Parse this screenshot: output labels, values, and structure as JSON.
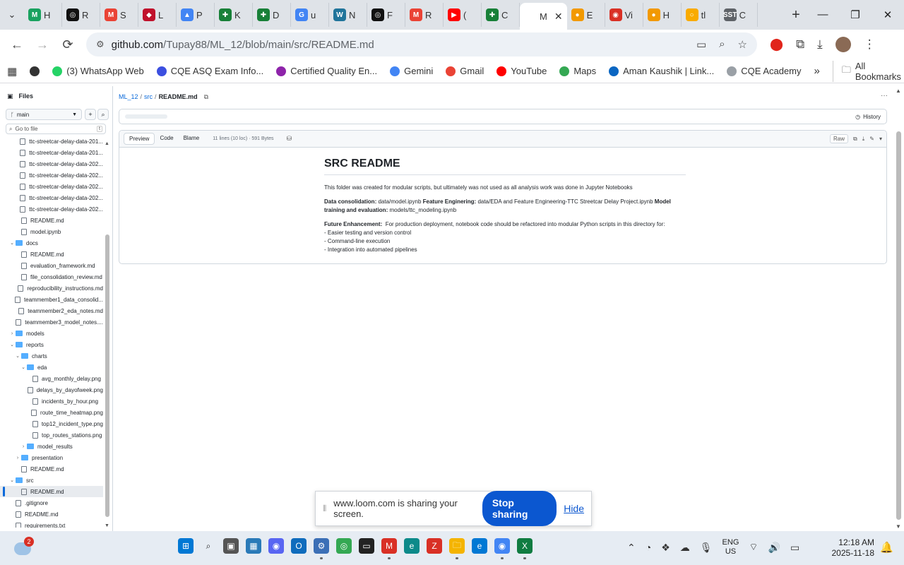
{
  "browser": {
    "tabs": [
      {
        "label": "H",
        "color": "#1aa260",
        "glyph": "M"
      },
      {
        "label": "R",
        "color": "#111111",
        "glyph": "◎"
      },
      {
        "label": "S",
        "color": "#ea4335",
        "glyph": "M"
      },
      {
        "label": "L",
        "color": "#c0122c",
        "glyph": "◆"
      },
      {
        "label": "P",
        "color": "#4285f4",
        "glyph": "▲"
      },
      {
        "label": "K",
        "color": "#188038",
        "glyph": "✚"
      },
      {
        "label": "D",
        "color": "#188038",
        "glyph": "✚"
      },
      {
        "label": "u",
        "color": "#4285f4",
        "glyph": "G"
      },
      {
        "label": "N",
        "color": "#21759b",
        "glyph": "W"
      },
      {
        "label": "F",
        "color": "#111111",
        "glyph": "◎"
      },
      {
        "label": "R",
        "color": "#ea4335",
        "glyph": "M"
      },
      {
        "label": "(",
        "color": "#ff0000",
        "glyph": "▶"
      },
      {
        "label": "C",
        "color": "#188038",
        "glyph": "✚"
      },
      {
        "label": "M",
        "color": "#ffffff",
        "glyph": "",
        "active": true
      },
      {
        "label": "E",
        "color": "#f29900",
        "glyph": "●"
      },
      {
        "label": "Vi",
        "color": "#d93025",
        "glyph": "◉"
      },
      {
        "label": "H",
        "color": "#f29900",
        "glyph": "●"
      },
      {
        "label": "tl",
        "color": "#f9ab00",
        "glyph": "○"
      },
      {
        "label": "C",
        "color": "#5f6368",
        "glyph": "SST"
      }
    ],
    "url_host": "github.com",
    "url_path": "/Tupay88/ML_12/blob/main/src/README.md",
    "bookmarks": [
      {
        "label": "",
        "color": "#333333"
      },
      {
        "label": "(3) WhatsApp Web",
        "color": "#25d366"
      },
      {
        "label": "CQE ASQ Exam Info...",
        "color": "#3c4fe0"
      },
      {
        "label": "Certified Quality En...",
        "color": "#8e24aa"
      },
      {
        "label": "Gemini",
        "color": "#4285f4"
      },
      {
        "label": "Gmail",
        "color": "#ea4335"
      },
      {
        "label": "YouTube",
        "color": "#ff0000"
      },
      {
        "label": "Maps",
        "color": "#34a853"
      },
      {
        "label": "Aman Kaushik | Link...",
        "color": "#0a66c2"
      },
      {
        "label": "CQE Academy",
        "color": "#9aa0a6"
      }
    ],
    "all_bookmarks": "All Bookmarks"
  },
  "sidebar": {
    "title": "Files",
    "branch": "main",
    "go_to_file": "Go to file",
    "go_to_kbd": "t",
    "tree": [
      {
        "label": "ttc-streetcar-delay-data-201...",
        "type": "file",
        "indent": 3
      },
      {
        "label": "ttc-streetcar-delay-data-201...",
        "type": "file",
        "indent": 3
      },
      {
        "label": "ttc-streetcar-delay-data-202...",
        "type": "file",
        "indent": 3
      },
      {
        "label": "ttc-streetcar-delay-data-202...",
        "type": "file",
        "indent": 3
      },
      {
        "label": "ttc-streetcar-delay-data-202...",
        "type": "file",
        "indent": 3
      },
      {
        "label": "ttc-streetcar-delay-data-202...",
        "type": "file",
        "indent": 3
      },
      {
        "label": "ttc-streetcar-delay-data-202...",
        "type": "file",
        "indent": 3
      },
      {
        "label": "README.md",
        "type": "file",
        "indent": 2
      },
      {
        "label": "model.ipynb",
        "type": "file",
        "indent": 2
      },
      {
        "label": "docs",
        "type": "folder",
        "indent": 1,
        "open": true
      },
      {
        "label": "README.md",
        "type": "file",
        "indent": 2
      },
      {
        "label": "evaluation_framework.md",
        "type": "file",
        "indent": 2
      },
      {
        "label": "file_consolidation_review.md",
        "type": "file",
        "indent": 2
      },
      {
        "label": "reproducibility_instructions.md",
        "type": "file",
        "indent": 2
      },
      {
        "label": "teammember1_data_consolid...",
        "type": "file",
        "indent": 2
      },
      {
        "label": "teammember2_eda_notes.md",
        "type": "file",
        "indent": 2
      },
      {
        "label": "teammember3_model_notes....",
        "type": "file",
        "indent": 2
      },
      {
        "label": "models",
        "type": "folder",
        "indent": 1,
        "open": false
      },
      {
        "label": "reports",
        "type": "folder",
        "indent": 1,
        "open": true
      },
      {
        "label": "charts",
        "type": "folder",
        "indent": 2,
        "open": true
      },
      {
        "label": "eda",
        "type": "folder",
        "indent": 3,
        "open": true
      },
      {
        "label": "avg_monthly_delay.png",
        "type": "file",
        "indent": 4
      },
      {
        "label": "delays_by_dayofweek.png",
        "type": "file",
        "indent": 4
      },
      {
        "label": "incidents_by_hour.png",
        "type": "file",
        "indent": 4
      },
      {
        "label": "route_time_heatmap.png",
        "type": "file",
        "indent": 4
      },
      {
        "label": "top12_incident_type.png",
        "type": "file",
        "indent": 4
      },
      {
        "label": "top_routes_stations.png",
        "type": "file",
        "indent": 4
      },
      {
        "label": "model_results",
        "type": "folder",
        "indent": 3,
        "open": false
      },
      {
        "label": "presentation",
        "type": "folder",
        "indent": 2,
        "open": false
      },
      {
        "label": "README.md",
        "type": "file",
        "indent": 2
      },
      {
        "label": "src",
        "type": "folder",
        "indent": 1,
        "open": true
      },
      {
        "label": "README.md",
        "type": "file",
        "indent": 2,
        "selected": true
      },
      {
        "label": ".gitignore",
        "type": "file",
        "indent": 1
      },
      {
        "label": "README.md",
        "type": "file",
        "indent": 1
      },
      {
        "label": "requirements.txt",
        "type": "file",
        "indent": 1
      }
    ]
  },
  "main": {
    "breadcrumb_repo": "ML_12",
    "breadcrumb_dir": "src",
    "breadcrumb_file": "README.md",
    "history": "History",
    "tabs": [
      "Preview",
      "Code",
      "Blame"
    ],
    "file_info": "11 lines (10 loc) · 591 Bytes",
    "raw": "Raw"
  },
  "readme": {
    "title": "SRC README",
    "intro": "This folder was created for modular scripts, but ultimately was not used as all analysis work was done in Jupyter Notebooks",
    "dc_label": "Data consolidation:",
    "dc_value": "data/model.ipynb",
    "fe_label": "Feature Enginering:",
    "fe_value": "data/EDA and Feature Engineering-TTC Streetcar Delay Project.ipynb",
    "mt_label": "Model training and evaluation:",
    "mt_value": "models/ttc_modeling.ipynb",
    "future_label": "Future Enhancement:",
    "future_value": "For production deployment, notebook code should be refactored into modular Python scripts in this directory for:",
    "bullets": [
      "- Easier testing and version control",
      "- Command-line execution",
      "- Integration into automated pipelines"
    ]
  },
  "loom": {
    "message": "www.loom.com is sharing your screen.",
    "stop": "Stop sharing",
    "hide": "Hide"
  },
  "taskbar": {
    "weather_badge": "2",
    "lang1": "ENG",
    "lang2": "US",
    "time": "12:18 AM",
    "date": "2025-11-18"
  }
}
